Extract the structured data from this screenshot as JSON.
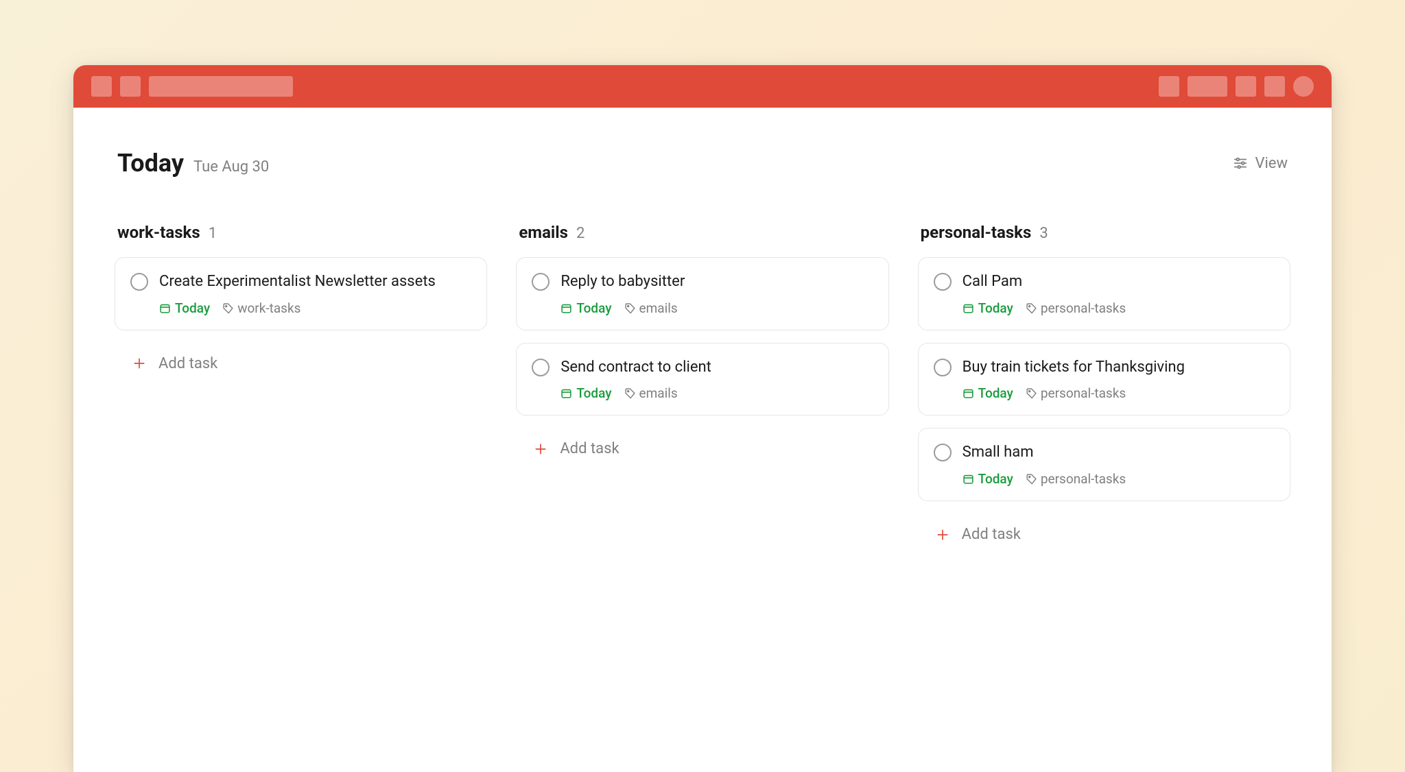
{
  "colors": {
    "accent": "#e04a38",
    "due": "#1a9c3e",
    "plus": "#e04a38"
  },
  "header": {
    "title": "Today",
    "date": "Tue Aug 30",
    "view_label": "View"
  },
  "add_task_label": "Add task",
  "due_label": "Today",
  "columns": [
    {
      "name": "work-tasks",
      "count": "1",
      "label_tag": "work-tasks",
      "tasks": [
        {
          "title": "Create Experimentalist Newsletter assets"
        }
      ]
    },
    {
      "name": "emails",
      "count": "2",
      "label_tag": "emails",
      "tasks": [
        {
          "title": "Reply to babysitter"
        },
        {
          "title": "Send contract to client"
        }
      ]
    },
    {
      "name": "personal-tasks",
      "count": "3",
      "label_tag": "personal-tasks",
      "tasks": [
        {
          "title": "Call Pam"
        },
        {
          "title": "Buy train tickets for Thanksgiving"
        },
        {
          "title": "Small ham"
        }
      ]
    }
  ]
}
